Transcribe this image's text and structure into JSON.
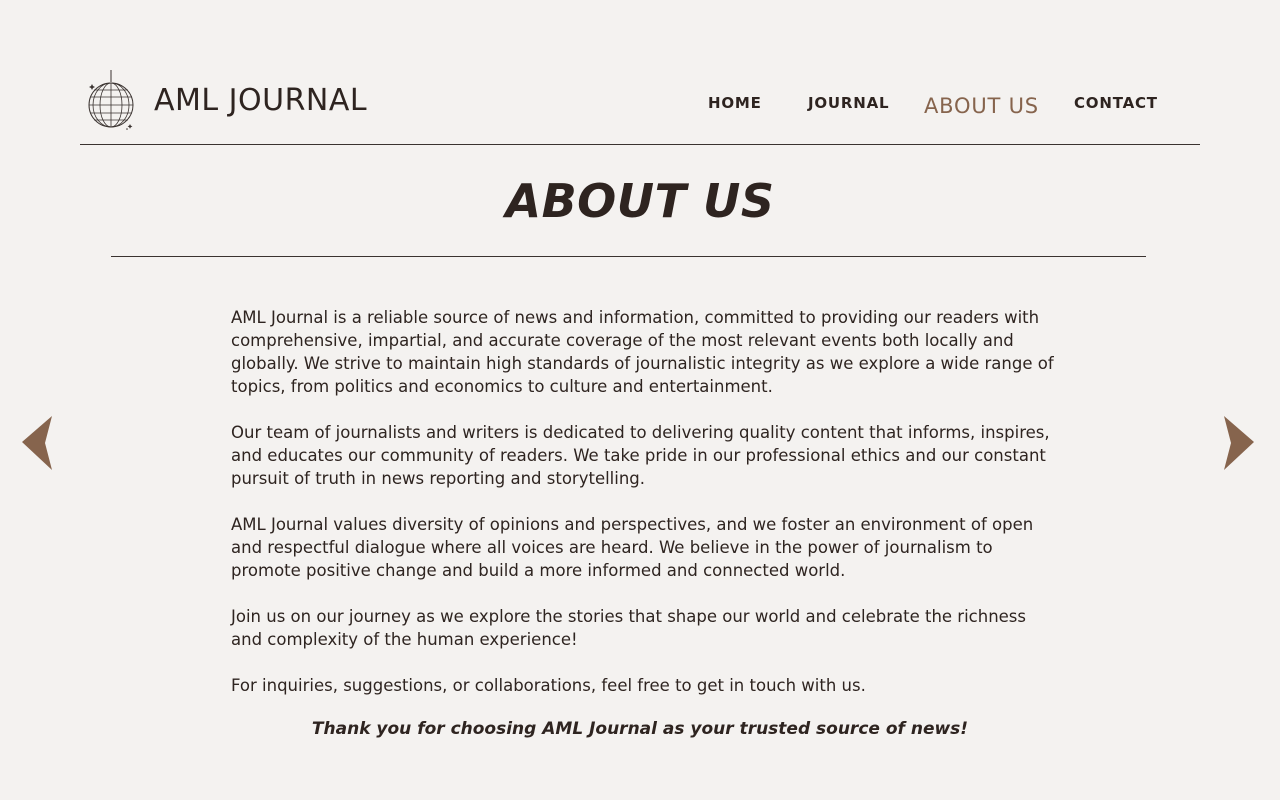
{
  "header": {
    "logo_text": "AML JOURNAL",
    "nav": {
      "home": "HOME",
      "journal": "JOURNAL",
      "about": "ABOUT US",
      "contact": "CONTACT"
    },
    "active_nav": "about"
  },
  "main": {
    "title": "ABOUT US",
    "paragraphs": [
      "AML Journal is a reliable source of news and information, committed to providing our readers with comprehensive, impartial, and accurate coverage of the most relevant events both locally and globally. We strive to maintain high standards of journalistic integrity as we explore a wide range of topics, from politics and economics to culture and entertainment.",
      "Our team of journalists and writers is dedicated to delivering quality content that informs, inspires, and educates our community of readers. We take pride in our professional ethics and our constant pursuit of truth in news reporting and storytelling.",
      "AML Journal values diversity of opinions and perspectives, and we foster an environment of open and respectful dialogue where all voices are heard. We believe in the power of journalism to promote positive change and build a more informed and connected world.",
      "Join us on our journey as we explore the stories that shape our world and celebrate the richness and complexity of the human experience!",
      "For inquiries, suggestions, or collaborations, feel free to get in touch with us."
    ],
    "closing": "Thank you for choosing AML Journal as your trusted source of news!"
  },
  "controls": {
    "prev_icon": "arrow-left-icon",
    "next_icon": "arrow-right-icon"
  },
  "colors": {
    "background": "#f4f2f0",
    "text": "#2e2420",
    "accent": "#86644d"
  }
}
